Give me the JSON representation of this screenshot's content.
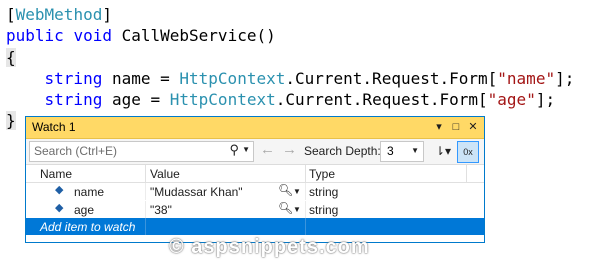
{
  "code": {
    "attribute_open": "[",
    "attribute_name": "WebMethod",
    "attribute_close": "]",
    "kw_public": "public",
    "kw_void": "void",
    "method_sig": " CallWebService()",
    "brace_open": "{",
    "kw_string_1": "string",
    "line3_mid": " name = ",
    "class_1": "HttpContext",
    "line3_access": ".Current.Request.Form[",
    "str_1": "\"name\"",
    "line3_end": "];",
    "kw_string_2": "string",
    "line4_mid": " age = ",
    "class_2": "HttpContext",
    "line4_access": ".Current.Request.Form[",
    "str_2": "\"age\"",
    "line4_end": "];",
    "brace_close": "}"
  },
  "watch": {
    "title": "Watch 1",
    "title_buttons": {
      "dropdown": "▾",
      "maximize": "□",
      "close": "✕"
    },
    "search_placeholder": "Search (Ctrl+E)",
    "search_icon": "⚲",
    "back_icon": "←",
    "forward_icon": "→",
    "depth_label": "Search Depth:",
    "depth_value": "3",
    "columns": {
      "name": "Name",
      "value": "Value",
      "type": "Type"
    },
    "rows": [
      {
        "name": "name",
        "value": "\"Mudassar Khan\"",
        "type": "string"
      },
      {
        "name": "age",
        "value": "\"38\"",
        "type": "string"
      }
    ],
    "add_item": "Add item to watch"
  },
  "watermark": "© aspsnippets.com"
}
